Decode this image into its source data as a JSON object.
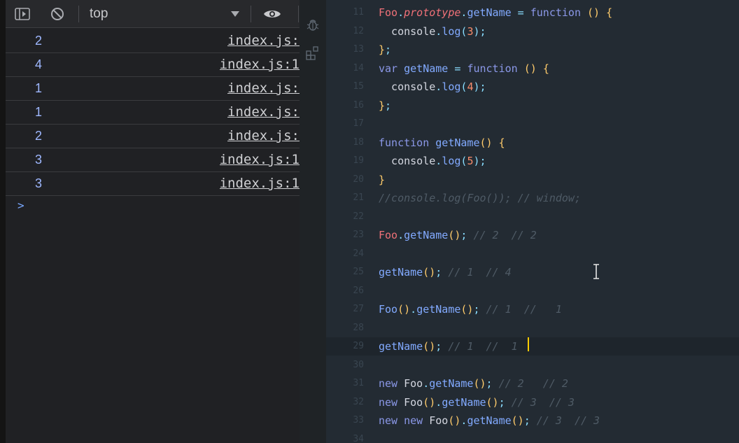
{
  "devtools": {
    "toolbar": {
      "icons": [
        "sidebar-toggle-icon",
        "clear-console-icon",
        "dropdown-arrow-icon",
        "eye-icon"
      ],
      "context": "top"
    },
    "messages": [
      {
        "value": "2",
        "source": "index.js:"
      },
      {
        "value": "4",
        "source": "index.js:1"
      },
      {
        "value": "1",
        "source": "index.js:"
      },
      {
        "value": "1",
        "source": "index.js:"
      },
      {
        "value": "2",
        "source": "index.js:"
      },
      {
        "value": "3",
        "source": "index.js:1"
      },
      {
        "value": "3",
        "source": "index.js:1"
      }
    ],
    "prompt_symbol": ">"
  },
  "activity_bar": {
    "icons": [
      "debug-bug-icon",
      "extensions-icon"
    ]
  },
  "editor": {
    "lines": [
      {
        "n": "11",
        "tokens": [
          {
            "t": "Foo",
            "c": "cls"
          },
          {
            "t": ".",
            "c": "p"
          },
          {
            "t": "prototype",
            "c": "prop"
          },
          {
            "t": ".",
            "c": "p"
          },
          {
            "t": "getName",
            "c": "fn"
          },
          {
            "t": " = ",
            "c": "p"
          },
          {
            "t": "function",
            "c": "kw"
          },
          {
            "t": " ",
            "c": "id"
          },
          {
            "t": "()",
            "c": "br"
          },
          {
            "t": " ",
            "c": "id"
          },
          {
            "t": "{",
            "c": "br"
          }
        ]
      },
      {
        "n": "12",
        "tokens": [
          {
            "t": "  console",
            "c": "id"
          },
          {
            "t": ".",
            "c": "p"
          },
          {
            "t": "log",
            "c": "fn"
          },
          {
            "t": "(",
            "c": "p"
          },
          {
            "t": "3",
            "c": "num"
          },
          {
            "t": ");",
            "c": "p"
          }
        ]
      },
      {
        "n": "13",
        "tokens": [
          {
            "t": "}",
            "c": "br"
          },
          {
            "t": ";",
            "c": "p"
          }
        ]
      },
      {
        "n": "14",
        "tokens": [
          {
            "t": "var",
            "c": "kw"
          },
          {
            "t": " getName",
            "c": "fn"
          },
          {
            "t": " = ",
            "c": "p"
          },
          {
            "t": "function",
            "c": "kw"
          },
          {
            "t": " ",
            "c": "id"
          },
          {
            "t": "()",
            "c": "br"
          },
          {
            "t": " ",
            "c": "id"
          },
          {
            "t": "{",
            "c": "br"
          }
        ]
      },
      {
        "n": "15",
        "tokens": [
          {
            "t": "  console",
            "c": "id"
          },
          {
            "t": ".",
            "c": "p"
          },
          {
            "t": "log",
            "c": "fn"
          },
          {
            "t": "(",
            "c": "p"
          },
          {
            "t": "4",
            "c": "num"
          },
          {
            "t": ");",
            "c": "p"
          }
        ]
      },
      {
        "n": "16",
        "tokens": [
          {
            "t": "}",
            "c": "br"
          },
          {
            "t": ";",
            "c": "p"
          }
        ]
      },
      {
        "n": "17",
        "tokens": []
      },
      {
        "n": "18",
        "tokens": [
          {
            "t": "function",
            "c": "kw"
          },
          {
            "t": " getName",
            "c": "fn"
          },
          {
            "t": "()",
            "c": "br"
          },
          {
            "t": " ",
            "c": "id"
          },
          {
            "t": "{",
            "c": "br"
          }
        ]
      },
      {
        "n": "19",
        "tokens": [
          {
            "t": "  console",
            "c": "id"
          },
          {
            "t": ".",
            "c": "p"
          },
          {
            "t": "log",
            "c": "fn"
          },
          {
            "t": "(",
            "c": "p"
          },
          {
            "t": "5",
            "c": "num"
          },
          {
            "t": ");",
            "c": "p"
          }
        ]
      },
      {
        "n": "20",
        "tokens": [
          {
            "t": "}",
            "c": "br"
          }
        ]
      },
      {
        "n": "21",
        "tokens": [
          {
            "t": "//console.log(Foo()); // window;",
            "c": "cm"
          }
        ]
      },
      {
        "n": "22",
        "tokens": []
      },
      {
        "n": "23",
        "tokens": [
          {
            "t": "Foo",
            "c": "cls"
          },
          {
            "t": ".",
            "c": "p"
          },
          {
            "t": "getName",
            "c": "fn"
          },
          {
            "t": "()",
            "c": "br"
          },
          {
            "t": ";",
            "c": "p"
          },
          {
            "t": " // 2  // 2",
            "c": "cm"
          }
        ]
      },
      {
        "n": "24",
        "tokens": []
      },
      {
        "n": "25",
        "tokens": [
          {
            "t": "getName",
            "c": "fn"
          },
          {
            "t": "()",
            "c": "br"
          },
          {
            "t": ";",
            "c": "p"
          },
          {
            "t": " // 1  // 4",
            "c": "cm"
          }
        ]
      },
      {
        "n": "26",
        "tokens": []
      },
      {
        "n": "27",
        "tokens": [
          {
            "t": "Foo",
            "c": "fn"
          },
          {
            "t": "()",
            "c": "br"
          },
          {
            "t": ".",
            "c": "p"
          },
          {
            "t": "getName",
            "c": "fn"
          },
          {
            "t": "()",
            "c": "br"
          },
          {
            "t": ";",
            "c": "p"
          },
          {
            "t": " // 1  //   1",
            "c": "cm"
          }
        ]
      },
      {
        "n": "28",
        "tokens": []
      },
      {
        "n": "29",
        "tokens": [
          {
            "t": "getName",
            "c": "fn"
          },
          {
            "t": "()",
            "c": "br"
          },
          {
            "t": ";",
            "c": "p"
          },
          {
            "t": " // 1  //  1",
            "c": "cm"
          }
        ]
      },
      {
        "n": "30",
        "tokens": []
      },
      {
        "n": "31",
        "tokens": [
          {
            "t": "new",
            "c": "kw"
          },
          {
            "t": " Foo",
            "c": "id"
          },
          {
            "t": ".",
            "c": "p"
          },
          {
            "t": "getName",
            "c": "fn"
          },
          {
            "t": "()",
            "c": "br"
          },
          {
            "t": ";",
            "c": "p"
          },
          {
            "t": " // 2   // 2",
            "c": "cm"
          }
        ]
      },
      {
        "n": "32",
        "tokens": [
          {
            "t": "new",
            "c": "kw"
          },
          {
            "t": " Foo",
            "c": "id"
          },
          {
            "t": "()",
            "c": "br"
          },
          {
            "t": ".",
            "c": "p"
          },
          {
            "t": "getName",
            "c": "fn"
          },
          {
            "t": "()",
            "c": "br"
          },
          {
            "t": ";",
            "c": "p"
          },
          {
            "t": " // 3  // 3",
            "c": "cm"
          }
        ]
      },
      {
        "n": "33",
        "tokens": [
          {
            "t": "new",
            "c": "kw"
          },
          {
            "t": " new",
            "c": "kw"
          },
          {
            "t": " Foo",
            "c": "id"
          },
          {
            "t": "()",
            "c": "br"
          },
          {
            "t": ".",
            "c": "p"
          },
          {
            "t": "getName",
            "c": "fn"
          },
          {
            "t": "()",
            "c": "br"
          },
          {
            "t": ";",
            "c": "p"
          },
          {
            "t": " // 3  // 3",
            "c": "cm"
          }
        ]
      },
      {
        "n": "34",
        "tokens": []
      }
    ],
    "current_line": "29"
  }
}
